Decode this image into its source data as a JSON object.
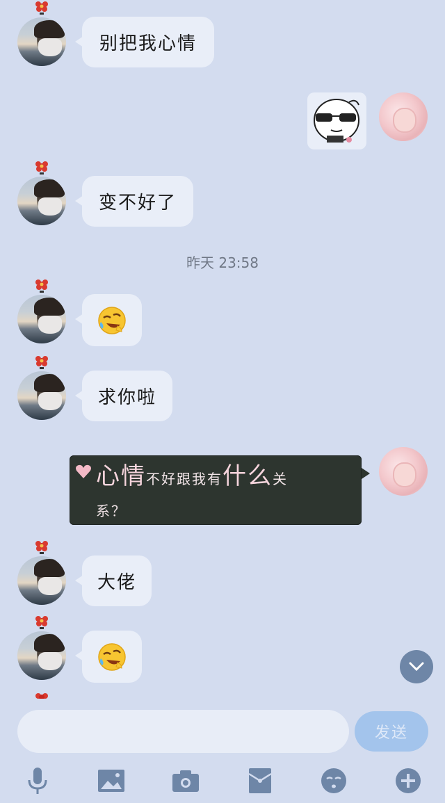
{
  "messages": [
    {
      "side": "left",
      "text": "别把我心情"
    },
    {
      "side": "right",
      "type": "sticker",
      "icon": "sunglasses-sticker"
    },
    {
      "side": "left",
      "text": "变不好了"
    },
    {
      "side": "left",
      "type": "emoji",
      "icon": "laughing-tears-emoji"
    },
    {
      "side": "left",
      "text": "求你啦"
    },
    {
      "side": "right",
      "type": "styled",
      "parts": [
        "心情",
        "不好跟我有",
        "什么",
        "关",
        "系？"
      ]
    },
    {
      "side": "left",
      "text": "大佬"
    },
    {
      "side": "left",
      "type": "emoji",
      "icon": "laughing-tears-emoji"
    }
  ],
  "timestamp": "昨天 23:58",
  "composer": {
    "send_label": "发送",
    "placeholder": ""
  },
  "toolbar": [
    "microphone-icon",
    "image-icon",
    "camera-icon",
    "red-packet-icon",
    "emoji-icon",
    "plus-icon"
  ],
  "colors": {
    "background": "#d3dcef",
    "bubble": "#e9eef8",
    "styled_bubble": "#2d352f",
    "send_button": "#a3c4ec",
    "icon": "#6e86a7"
  }
}
